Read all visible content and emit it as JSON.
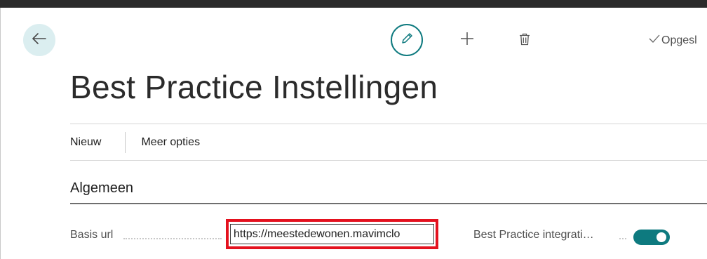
{
  "toolbar": {
    "back_icon": "arrow-left-icon",
    "edit_icon": "pencil-icon",
    "add_icon": "plus-icon",
    "delete_icon": "trash-icon",
    "saved_icon": "check-icon",
    "saved_text": "Opgesl"
  },
  "page": {
    "title": "Best Practice Instellingen"
  },
  "actions": {
    "new_label": "Nieuw",
    "more_label": "Meer opties"
  },
  "section": {
    "title": "Algemeen"
  },
  "fields": {
    "basis_url": {
      "label": "Basis url",
      "value": "https://meestedewonen.mavimclo"
    },
    "integration": {
      "label": "Best Practice integrati…",
      "enabled": true
    }
  },
  "colors": {
    "accent": "#0e7a7f",
    "back_button_bg": "#dbeef0",
    "highlight": "#e4111e"
  }
}
